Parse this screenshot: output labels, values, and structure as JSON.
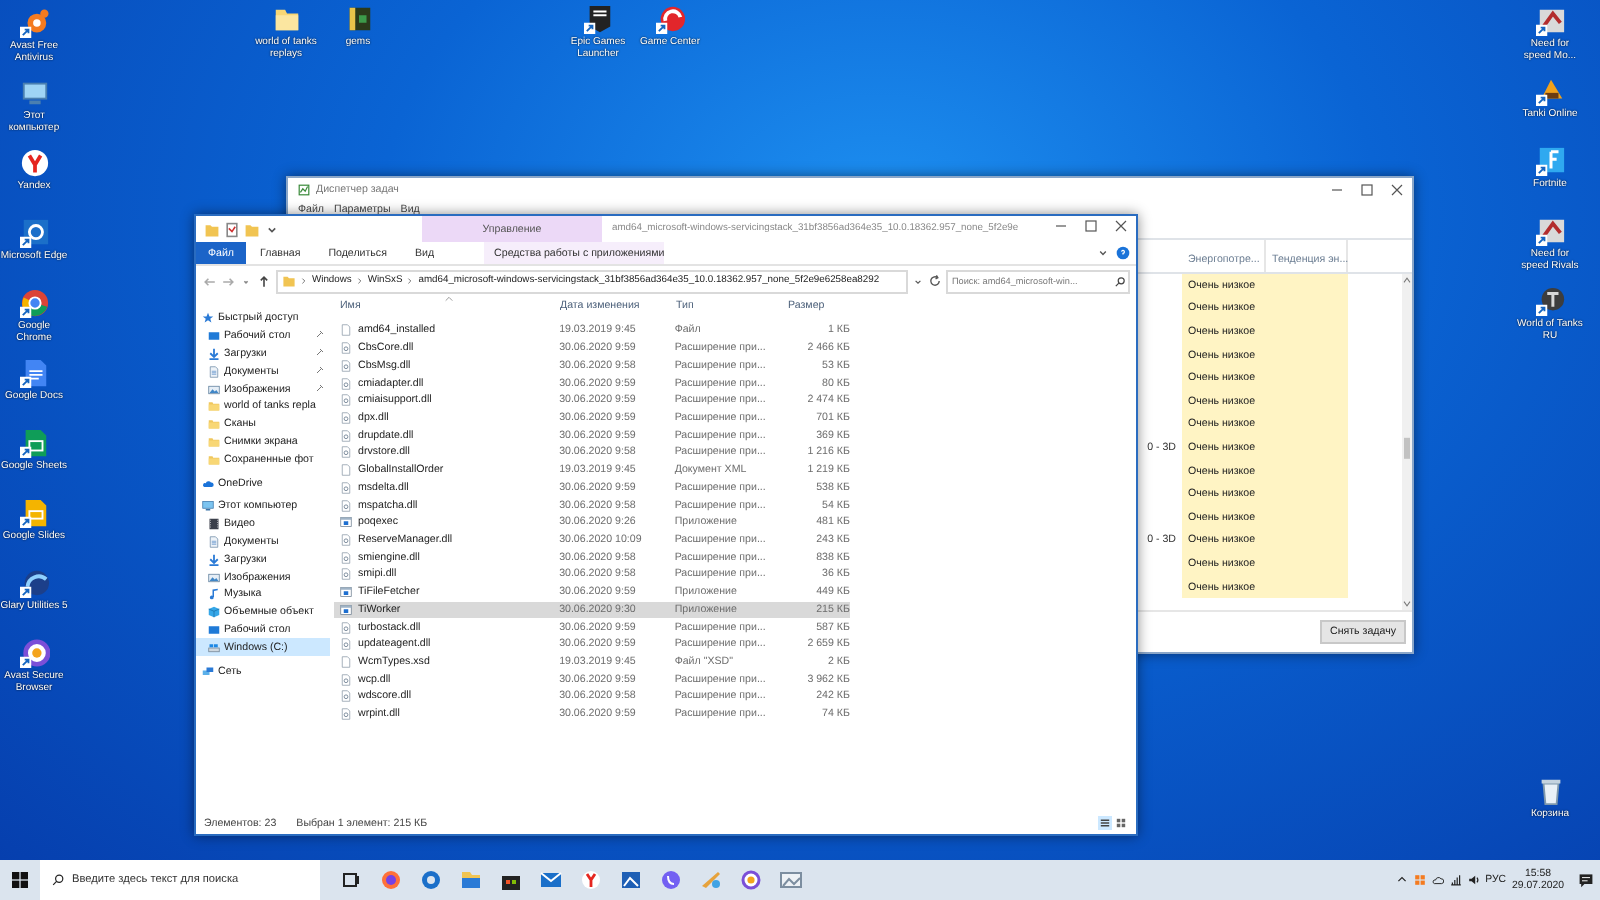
{
  "desktop": {
    "left_icons": [
      {
        "label": "Avast Free Antivirus",
        "kind": "avast"
      },
      {
        "label": "Этот компьютер",
        "kind": "computer"
      },
      {
        "label": "Yandex",
        "kind": "yandex"
      },
      {
        "label": "Microsoft Edge",
        "kind": "edge"
      },
      {
        "label": "Google Chrome",
        "kind": "chrome"
      },
      {
        "label": "Google Docs",
        "kind": "docs"
      },
      {
        "label": "Google Sheets",
        "kind": "sheets"
      },
      {
        "label": "Google Slides",
        "kind": "slides"
      },
      {
        "label": "Glary Utilities 5",
        "kind": "glary"
      },
      {
        "label": "Avast Secure Browser",
        "kind": "ring"
      }
    ],
    "top_icons": [
      {
        "label": "world of tanks replays",
        "kind": "folder"
      },
      {
        "label": "gems",
        "kind": "gems"
      }
    ],
    "top_icons_2": [
      {
        "label": "Epic Games Launcher",
        "kind": "epic"
      },
      {
        "label": "Game Center",
        "kind": "gamecenter"
      }
    ],
    "right_icons": [
      {
        "label": "Need for speed Mo...",
        "kind": "nfs"
      },
      {
        "label": "Tanki Online",
        "kind": "tanki"
      },
      {
        "label": "Fortnite",
        "kind": "fortnite"
      },
      {
        "label": "Need for speed Rivals",
        "kind": "nfs"
      },
      {
        "label": "World of Tanks RU",
        "kind": "wot"
      }
    ],
    "recycle_bin": {
      "label": "Корзина",
      "kind": "bin"
    }
  },
  "task_manager": {
    "title": "Диспетчер задач",
    "menu": [
      "Файл",
      "Параметры",
      "Вид"
    ],
    "columns": [
      "Энергопотре...",
      "Тенденция эн..."
    ],
    "rows": [
      {
        "energy": "Очень низкое"
      },
      {
        "energy": "Очень низкое"
      },
      {
        "energy": "Очень низкое"
      },
      {
        "energy": "Очень низкое"
      },
      {
        "energy": "Очень низкое"
      },
      {
        "energy": "Очень низкое"
      },
      {
        "energy": "Очень низкое"
      },
      {
        "column_1": "0 - 3D",
        "energy": "Очень низкое"
      },
      {
        "energy": "Очень низкое"
      },
      {
        "energy": "Очень низкое"
      },
      {
        "energy": "Очень низкое"
      },
      {
        "column_1": "0 - 3D",
        "energy": "Очень низкое"
      },
      {
        "energy": "Очень низкое"
      },
      {
        "energy": "Очень низкое"
      }
    ],
    "button": "Снять задачу"
  },
  "explorer": {
    "context_tab": "Управление",
    "title": "amd64_microsoft-windows-servicingstack_31bf3856ad364e35_10.0.18362.957_none_5f2e9e",
    "ribbon_tabs": [
      {
        "label": "Файл",
        "kind": "file"
      },
      {
        "label": "Главная",
        "kind": "tab"
      },
      {
        "label": "Поделиться",
        "kind": "tab"
      },
      {
        "label": "Вид",
        "kind": "tab"
      },
      {
        "label": "Средства работы с приложениями",
        "kind": "context"
      }
    ],
    "breadcrumbs": [
      "Windows",
      "WinSxS",
      "amd64_microsoft-windows-servicingstack_31bf3856ad364e35_10.0.18362.957_none_5f2e9e6258ea8292"
    ],
    "search": {
      "placeholder": "Поиск: amd64_microsoft-win..."
    },
    "nav": [
      {
        "label": "Быстрый доступ",
        "kind": "star",
        "selected": false,
        "children": [
          {
            "label": "Рабочий стол",
            "kind": "desktop",
            "pinned": true,
            "selected": false
          },
          {
            "label": "Загрузки",
            "kind": "download",
            "pinned": true,
            "selected": false
          },
          {
            "label": "Документы",
            "kind": "documents",
            "pinned": true,
            "selected": false
          },
          {
            "label": "Изображения",
            "kind": "pictures",
            "pinned": true,
            "selected": false
          },
          {
            "label": "world of tanks repla",
            "kind": "folder",
            "pinned": false,
            "selected": false
          },
          {
            "label": "Сканы",
            "kind": "folder",
            "pinned": false,
            "selected": false
          },
          {
            "label": "Снимки экрана",
            "kind": "folder",
            "pinned": false,
            "selected": false
          },
          {
            "label": "Сохраненные фот",
            "kind": "folder",
            "pinned": false,
            "selected": false
          }
        ]
      },
      {
        "label": "OneDrive",
        "kind": "cloud",
        "selected": false
      },
      {
        "label": "Этот компьютер",
        "kind": "computer",
        "selected": false,
        "children": [
          {
            "label": "Видео",
            "kind": "video",
            "pinned": false,
            "selected": false
          },
          {
            "label": "Документы",
            "kind": "documents",
            "pinned": false,
            "selected": false
          },
          {
            "label": "Загрузки",
            "kind": "download",
            "pinned": false,
            "selected": false
          },
          {
            "label": "Изображения",
            "kind": "pictures",
            "pinned": false,
            "selected": false
          },
          {
            "label": "Музыка",
            "kind": "music",
            "pinned": false,
            "selected": false
          },
          {
            "label": "Объемные объект",
            "kind": "cube",
            "pinned": false,
            "selected": false
          },
          {
            "label": "Рабочий стол",
            "kind": "desktop",
            "pinned": false,
            "selected": false
          },
          {
            "label": "Windows (C:)",
            "kind": "drive",
            "pinned": false,
            "selected": true
          }
        ]
      },
      {
        "label": "Сеть",
        "kind": "network",
        "selected": false
      }
    ],
    "columns": [
      "Имя",
      "Дата изменения",
      "Тип",
      "Размер"
    ],
    "files": [
      {
        "name": "amd64_installed",
        "date": "19.03.2019 9:45",
        "type": "Файл",
        "size": "1 КБ",
        "kind": "file",
        "selected": false
      },
      {
        "name": "CbsCore.dll",
        "date": "30.06.2020 9:59",
        "type": "Расширение при...",
        "size": "2 466 КБ",
        "kind": "dll",
        "selected": false
      },
      {
        "name": "CbsMsg.dll",
        "date": "30.06.2020 9:58",
        "type": "Расширение при...",
        "size": "53 КБ",
        "kind": "dll",
        "selected": false
      },
      {
        "name": "cmiadapter.dll",
        "date": "30.06.2020 9:59",
        "type": "Расширение при...",
        "size": "80 КБ",
        "kind": "dll",
        "selected": false
      },
      {
        "name": "cmiaisupport.dll",
        "date": "30.06.2020 9:59",
        "type": "Расширение при...",
        "size": "2 474 КБ",
        "kind": "dll",
        "selected": false
      },
      {
        "name": "dpx.dll",
        "date": "30.06.2020 9:59",
        "type": "Расширение при...",
        "size": "701 КБ",
        "kind": "dll",
        "selected": false
      },
      {
        "name": "drupdate.dll",
        "date": "30.06.2020 9:59",
        "type": "Расширение при...",
        "size": "369 КБ",
        "kind": "dll",
        "selected": false
      },
      {
        "name": "drvstore.dll",
        "date": "30.06.2020 9:58",
        "type": "Расширение при...",
        "size": "1 216 КБ",
        "kind": "dll",
        "selected": false
      },
      {
        "name": "GlobalInstallOrder",
        "date": "19.03.2019 9:45",
        "type": "Документ XML",
        "size": "1 219 КБ",
        "kind": "file",
        "selected": false
      },
      {
        "name": "msdelta.dll",
        "date": "30.06.2020 9:59",
        "type": "Расширение при...",
        "size": "538 КБ",
        "kind": "dll",
        "selected": false
      },
      {
        "name": "mspatcha.dll",
        "date": "30.06.2020 9:58",
        "type": "Расширение при...",
        "size": "54 КБ",
        "kind": "dll",
        "selected": false
      },
      {
        "name": "poqexec",
        "date": "30.06.2020 9:26",
        "type": "Приложение",
        "size": "481 КБ",
        "kind": "exe",
        "selected": false
      },
      {
        "name": "ReserveManager.dll",
        "date": "30.06.2020 10:09",
        "type": "Расширение при...",
        "size": "243 КБ",
        "kind": "dll",
        "selected": false
      },
      {
        "name": "smiengine.dll",
        "date": "30.06.2020 9:58",
        "type": "Расширение при...",
        "size": "838 КБ",
        "kind": "dll",
        "selected": false
      },
      {
        "name": "smipi.dll",
        "date": "30.06.2020 9:58",
        "type": "Расширение при...",
        "size": "36 КБ",
        "kind": "dll",
        "selected": false
      },
      {
        "name": "TiFileFetcher",
        "date": "30.06.2020 9:59",
        "type": "Приложение",
        "size": "449 КБ",
        "kind": "exe",
        "selected": false
      },
      {
        "name": "TiWorker",
        "date": "30.06.2020 9:30",
        "type": "Приложение",
        "size": "215 КБ",
        "kind": "exe",
        "selected": true
      },
      {
        "name": "turbostack.dll",
        "date": "30.06.2020 9:59",
        "type": "Расширение при...",
        "size": "587 КБ",
        "kind": "dll",
        "selected": false
      },
      {
        "name": "updateagent.dll",
        "date": "30.06.2020 9:59",
        "type": "Расширение при...",
        "size": "2 659 КБ",
        "kind": "dll",
        "selected": false
      },
      {
        "name": "WcmTypes.xsd",
        "date": "19.03.2019 9:45",
        "type": "Файл \"XSD\"",
        "size": "2 КБ",
        "kind": "file",
        "selected": false
      },
      {
        "name": "wcp.dll",
        "date": "30.06.2020 9:59",
        "type": "Расширение при...",
        "size": "3 962 КБ",
        "kind": "dll",
        "selected": false
      },
      {
        "name": "wdscore.dll",
        "date": "30.06.2020 9:58",
        "type": "Расширение при...",
        "size": "242 КБ",
        "kind": "dll",
        "selected": false
      },
      {
        "name": "wrpint.dll",
        "date": "30.06.2020 9:59",
        "type": "Расширение при...",
        "size": "74 КБ",
        "kind": "dll",
        "selected": false
      }
    ],
    "status_count": "Элементов: 23",
    "status_selection": "Выбран 1 элемент: 215 КБ"
  },
  "taskbar": {
    "search": {
      "placeholder": "Введите здесь текст для поиска"
    },
    "language": "РУС",
    "time": "15:58",
    "date": "29.07.2020"
  }
}
